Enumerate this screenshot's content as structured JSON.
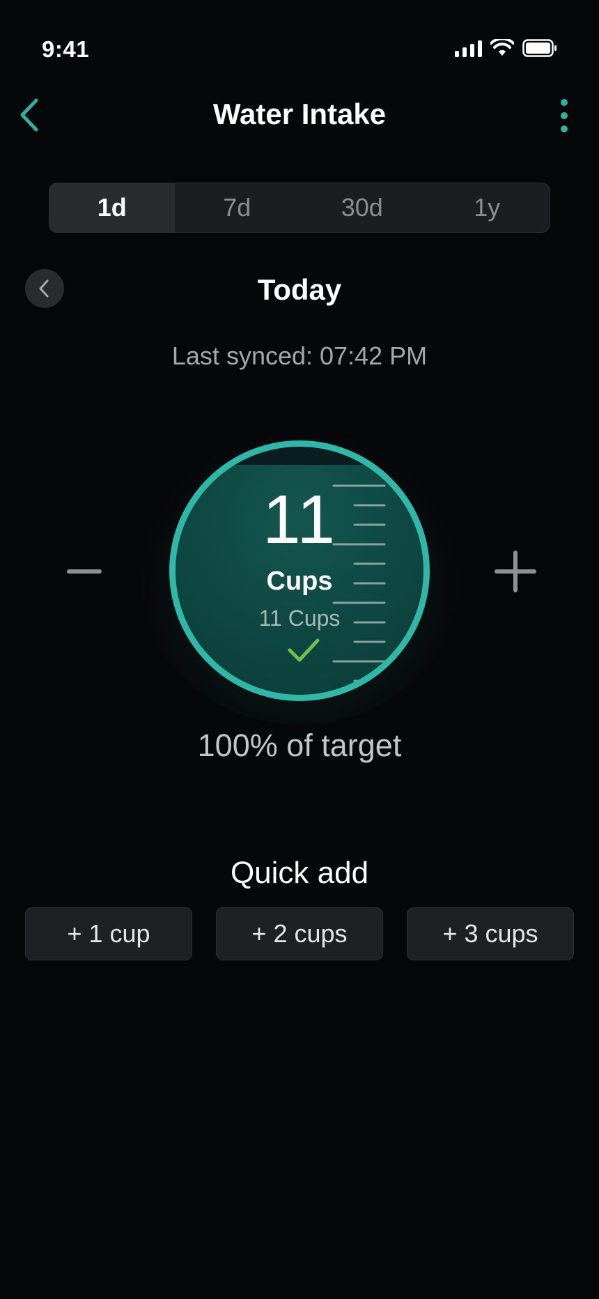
{
  "status_bar": {
    "time": "9:41",
    "icons": [
      "signal-icon",
      "wifi-icon",
      "battery-icon"
    ]
  },
  "nav": {
    "title": "Water Intake",
    "back_icon": "chevron-left-icon",
    "menu_icon": "more-vertical-icon"
  },
  "range_tabs": {
    "items": [
      {
        "label": "1d",
        "active": true
      },
      {
        "label": "7d",
        "active": false
      },
      {
        "label": "30d",
        "active": false
      },
      {
        "label": "1y",
        "active": false
      }
    ]
  },
  "day_nav": {
    "prev_icon": "chevron-left-icon",
    "title": "Today"
  },
  "sync": {
    "text": "Last synced: 07:42 PM"
  },
  "gauge": {
    "value": "11",
    "unit": "Cups",
    "goal_text": "11 Cups",
    "goal_met_icon": "checkmark-icon",
    "decrement_icon": "minus-icon",
    "increment_icon": "plus-icon",
    "progress_percent": 100,
    "target_text": "100% of target"
  },
  "quick_add": {
    "title": "Quick add",
    "buttons": [
      {
        "label": "+ 1 cup"
      },
      {
        "label": "+ 2 cups"
      },
      {
        "label": "+ 3 cups"
      }
    ]
  },
  "colors": {
    "background": "#060709",
    "accent": "#2fb8a7",
    "check": "#6cc24a",
    "muted_text": "#a6a7ab"
  }
}
